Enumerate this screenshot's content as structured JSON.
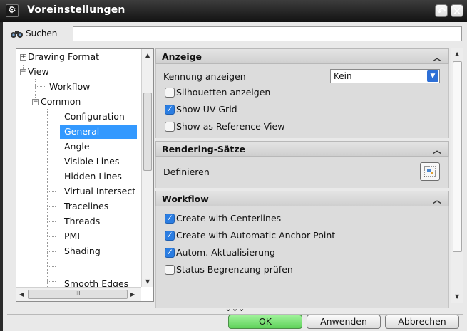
{
  "window": {
    "title": "Voreinstellungen",
    "icon": "gear-icon",
    "controls": [
      "↶",
      "✕"
    ]
  },
  "search": {
    "label": "Suchen",
    "value": "",
    "placeholder": ""
  },
  "tree": {
    "items": [
      {
        "label": "Drawing Format",
        "toggle": "+",
        "selected": false
      },
      {
        "label": "View",
        "toggle": "−",
        "selected": false
      },
      {
        "label": "Workflow",
        "toggle": "",
        "selected": false
      },
      {
        "label": "Common",
        "toggle": "−",
        "selected": false
      },
      {
        "label": "Configuration",
        "toggle": "",
        "selected": false
      },
      {
        "label": "General",
        "toggle": "",
        "selected": true
      },
      {
        "label": "Angle",
        "toggle": "",
        "selected": false
      },
      {
        "label": "Visible Lines",
        "toggle": "",
        "selected": false
      },
      {
        "label": "Hidden Lines",
        "toggle": "",
        "selected": false
      },
      {
        "label": "Virtual Intersect",
        "toggle": "",
        "selected": false
      },
      {
        "label": "Tracelines",
        "toggle": "",
        "selected": false
      },
      {
        "label": "Threads",
        "toggle": "",
        "selected": false
      },
      {
        "label": "PMI",
        "toggle": "",
        "selected": false
      },
      {
        "label": "Shading",
        "toggle": "",
        "selected": false
      },
      {
        "label": "Smooth Edges",
        "toggle": "",
        "selected": false
      }
    ],
    "hscroll_grip": "III"
  },
  "sections": {
    "anzeige": {
      "title": "Anzeige",
      "kennung_label": "Kennung anzeigen",
      "kennung_value": "Kein",
      "options": [
        {
          "label": "Silhouetten anzeigen",
          "checked": false
        },
        {
          "label": "Show UV Grid",
          "checked": true
        },
        {
          "label": "Show as Reference View",
          "checked": false
        }
      ]
    },
    "rendering": {
      "title": "Rendering-Sätze",
      "define_label": "Definieren"
    },
    "workflow": {
      "title": "Workflow",
      "options": [
        {
          "label": "Create with Centerlines",
          "checked": true
        },
        {
          "label": "Create with Automatic Anchor Point",
          "checked": true
        },
        {
          "label": "Autom. Aktualisierung",
          "checked": true
        },
        {
          "label": "Status Begrenzung prüfen",
          "checked": false
        }
      ]
    }
  },
  "more_glyph": "⌄⌄⌄",
  "buttons": {
    "ok": "OK",
    "apply": "Anwenden",
    "cancel": "Abbrechen"
  },
  "colors": {
    "selection": "#3399ff",
    "ok_button": "#6fdc69",
    "checkbox_checked": "#2b7de1"
  }
}
